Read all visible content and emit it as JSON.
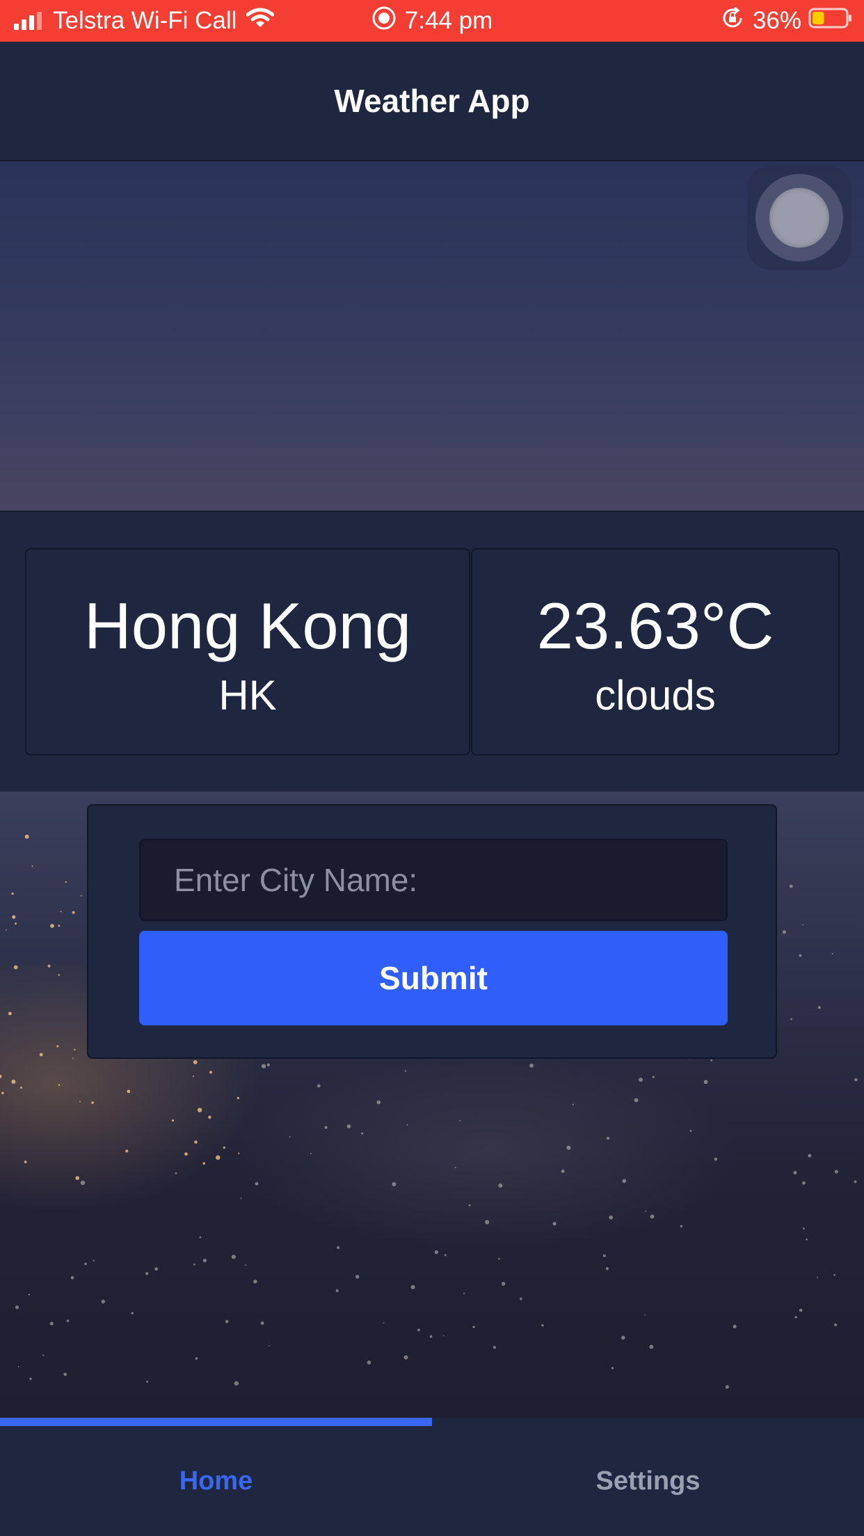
{
  "status_bar": {
    "carrier": "Telstra Wi-Fi Call",
    "time": "7:44 pm",
    "battery_percent": "36%",
    "battery_level": 0.36,
    "signal_icon": "signal-bars-icon",
    "wifi_icon": "wifi-icon",
    "recording_icon": "screen-recording-icon",
    "orientation_lock_icon": "orientation-lock-icon",
    "battery_icon": "battery-icon",
    "background_color": "#f43e33"
  },
  "nav": {
    "title": "Weather App"
  },
  "weather": {
    "city": "Hong Kong",
    "country": "HK",
    "temperature": "23.63°C",
    "condition": "clouds"
  },
  "form": {
    "city_placeholder": "Enter City Name:",
    "city_value": "",
    "submit_label": "Submit"
  },
  "tabs": [
    {
      "label": "Home",
      "active": true
    },
    {
      "label": "Settings",
      "active": false
    }
  ],
  "colors": {
    "panel": "#1f2740",
    "accent": "#2f5ef9",
    "active_tab": "#3a67f2",
    "inactive_tab": "#9aa0b3",
    "text": "#ffffff"
  }
}
